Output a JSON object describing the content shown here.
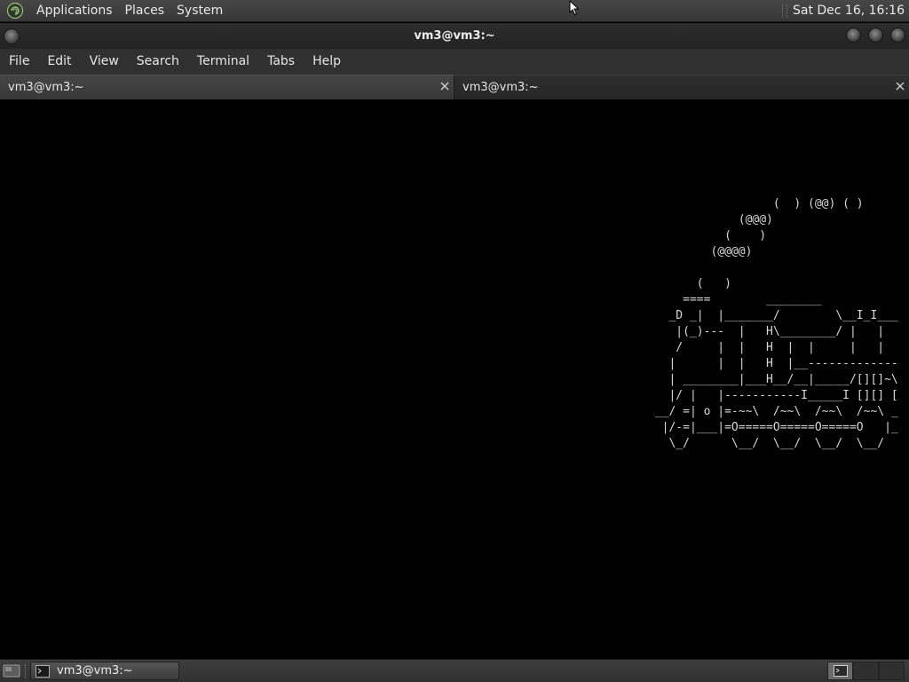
{
  "top_panel": {
    "menus": [
      "Applications",
      "Places",
      "System"
    ],
    "clock": "Sat Dec 16, 16:16"
  },
  "window": {
    "title": "vm3@vm3:~"
  },
  "menubar": [
    "File",
    "Edit",
    "View",
    "Search",
    "Terminal",
    "Tabs",
    "Help"
  ],
  "tabs": [
    {
      "label": "vm3@vm3:~",
      "state": "inactive"
    },
    {
      "label": "vm3@vm3:~",
      "state": "active"
    }
  ],
  "terminal": {
    "content": "                  (  ) (@@) ( )\n             (@@@)\n           (    )\n         (@@@@)\n\n       (   )\n     ====        ________\n   _D _|  |_______/        \\__I_I___\n    |(_)---  |   H\\________/ |   |\n    /     |  |   H  |  |     |   |\n   |      |  |   H  |__-------------\n   | ________|___H__/__|_____/[][]~\\\n   |/ |   |-----------I_____I [][] [\n __/ =| o |=-~~\\  /~~\\  /~~\\  /~~\\ _\n  |/-=|___|=O=====O=====O=====O   |_\n   \\_/      \\__/  \\__/  \\__/  \\__/"
  },
  "bottom_panel": {
    "task_label": "vm3@vm3:~"
  },
  "colors": {
    "panel_bg": "#3a3a3a",
    "terminal_bg": "#000000",
    "terminal_fg": "#d8d8d8",
    "text": "#e6e6e6"
  }
}
